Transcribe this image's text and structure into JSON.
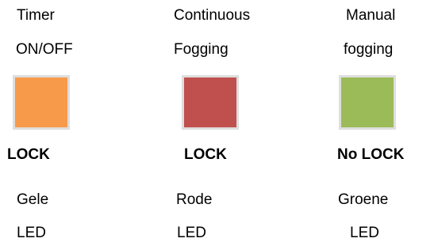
{
  "items": [
    {
      "label_line1": "Timer",
      "label_line2": "ON/OFF",
      "color": "#f79a4a",
      "lock": "LOCK",
      "led_line1": "Gele",
      "led_line2": "LED"
    },
    {
      "label_line1": "Continuous",
      "label_line2": "Fogging",
      "color": "#c0504d",
      "lock": "LOCK",
      "led_line1": "Rode",
      "led_line2": "LED"
    },
    {
      "label_line1": "Manual",
      "label_line2": "fogging",
      "color": "#9bbb59",
      "lock": "No LOCK",
      "led_line1": "Groene",
      "led_line2": "LED"
    }
  ]
}
